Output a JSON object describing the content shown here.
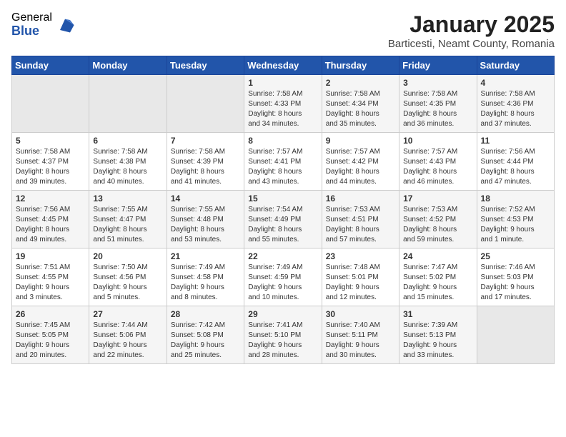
{
  "logo": {
    "general": "General",
    "blue": "Blue"
  },
  "header": {
    "title": "January 2025",
    "location": "Barticesti, Neamt County, Romania"
  },
  "days_of_week": [
    "Sunday",
    "Monday",
    "Tuesday",
    "Wednesday",
    "Thursday",
    "Friday",
    "Saturday"
  ],
  "weeks": [
    [
      {
        "day": "",
        "content": ""
      },
      {
        "day": "",
        "content": ""
      },
      {
        "day": "",
        "content": ""
      },
      {
        "day": "1",
        "content": "Sunrise: 7:58 AM\nSunset: 4:33 PM\nDaylight: 8 hours\nand 34 minutes."
      },
      {
        "day": "2",
        "content": "Sunrise: 7:58 AM\nSunset: 4:34 PM\nDaylight: 8 hours\nand 35 minutes."
      },
      {
        "day": "3",
        "content": "Sunrise: 7:58 AM\nSunset: 4:35 PM\nDaylight: 8 hours\nand 36 minutes."
      },
      {
        "day": "4",
        "content": "Sunrise: 7:58 AM\nSunset: 4:36 PM\nDaylight: 8 hours\nand 37 minutes."
      }
    ],
    [
      {
        "day": "5",
        "content": "Sunrise: 7:58 AM\nSunset: 4:37 PM\nDaylight: 8 hours\nand 39 minutes."
      },
      {
        "day": "6",
        "content": "Sunrise: 7:58 AM\nSunset: 4:38 PM\nDaylight: 8 hours\nand 40 minutes."
      },
      {
        "day": "7",
        "content": "Sunrise: 7:58 AM\nSunset: 4:39 PM\nDaylight: 8 hours\nand 41 minutes."
      },
      {
        "day": "8",
        "content": "Sunrise: 7:57 AM\nSunset: 4:41 PM\nDaylight: 8 hours\nand 43 minutes."
      },
      {
        "day": "9",
        "content": "Sunrise: 7:57 AM\nSunset: 4:42 PM\nDaylight: 8 hours\nand 44 minutes."
      },
      {
        "day": "10",
        "content": "Sunrise: 7:57 AM\nSunset: 4:43 PM\nDaylight: 8 hours\nand 46 minutes."
      },
      {
        "day": "11",
        "content": "Sunrise: 7:56 AM\nSunset: 4:44 PM\nDaylight: 8 hours\nand 47 minutes."
      }
    ],
    [
      {
        "day": "12",
        "content": "Sunrise: 7:56 AM\nSunset: 4:45 PM\nDaylight: 8 hours\nand 49 minutes."
      },
      {
        "day": "13",
        "content": "Sunrise: 7:55 AM\nSunset: 4:47 PM\nDaylight: 8 hours\nand 51 minutes."
      },
      {
        "day": "14",
        "content": "Sunrise: 7:55 AM\nSunset: 4:48 PM\nDaylight: 8 hours\nand 53 minutes."
      },
      {
        "day": "15",
        "content": "Sunrise: 7:54 AM\nSunset: 4:49 PM\nDaylight: 8 hours\nand 55 minutes."
      },
      {
        "day": "16",
        "content": "Sunrise: 7:53 AM\nSunset: 4:51 PM\nDaylight: 8 hours\nand 57 minutes."
      },
      {
        "day": "17",
        "content": "Sunrise: 7:53 AM\nSunset: 4:52 PM\nDaylight: 8 hours\nand 59 minutes."
      },
      {
        "day": "18",
        "content": "Sunrise: 7:52 AM\nSunset: 4:53 PM\nDaylight: 9 hours\nand 1 minute."
      }
    ],
    [
      {
        "day": "19",
        "content": "Sunrise: 7:51 AM\nSunset: 4:55 PM\nDaylight: 9 hours\nand 3 minutes."
      },
      {
        "day": "20",
        "content": "Sunrise: 7:50 AM\nSunset: 4:56 PM\nDaylight: 9 hours\nand 5 minutes."
      },
      {
        "day": "21",
        "content": "Sunrise: 7:49 AM\nSunset: 4:58 PM\nDaylight: 9 hours\nand 8 minutes."
      },
      {
        "day": "22",
        "content": "Sunrise: 7:49 AM\nSunset: 4:59 PM\nDaylight: 9 hours\nand 10 minutes."
      },
      {
        "day": "23",
        "content": "Sunrise: 7:48 AM\nSunset: 5:01 PM\nDaylight: 9 hours\nand 12 minutes."
      },
      {
        "day": "24",
        "content": "Sunrise: 7:47 AM\nSunset: 5:02 PM\nDaylight: 9 hours\nand 15 minutes."
      },
      {
        "day": "25",
        "content": "Sunrise: 7:46 AM\nSunset: 5:03 PM\nDaylight: 9 hours\nand 17 minutes."
      }
    ],
    [
      {
        "day": "26",
        "content": "Sunrise: 7:45 AM\nSunset: 5:05 PM\nDaylight: 9 hours\nand 20 minutes."
      },
      {
        "day": "27",
        "content": "Sunrise: 7:44 AM\nSunset: 5:06 PM\nDaylight: 9 hours\nand 22 minutes."
      },
      {
        "day": "28",
        "content": "Sunrise: 7:42 AM\nSunset: 5:08 PM\nDaylight: 9 hours\nand 25 minutes."
      },
      {
        "day": "29",
        "content": "Sunrise: 7:41 AM\nSunset: 5:10 PM\nDaylight: 9 hours\nand 28 minutes."
      },
      {
        "day": "30",
        "content": "Sunrise: 7:40 AM\nSunset: 5:11 PM\nDaylight: 9 hours\nand 30 minutes."
      },
      {
        "day": "31",
        "content": "Sunrise: 7:39 AM\nSunset: 5:13 PM\nDaylight: 9 hours\nand 33 minutes."
      },
      {
        "day": "",
        "content": ""
      }
    ]
  ]
}
